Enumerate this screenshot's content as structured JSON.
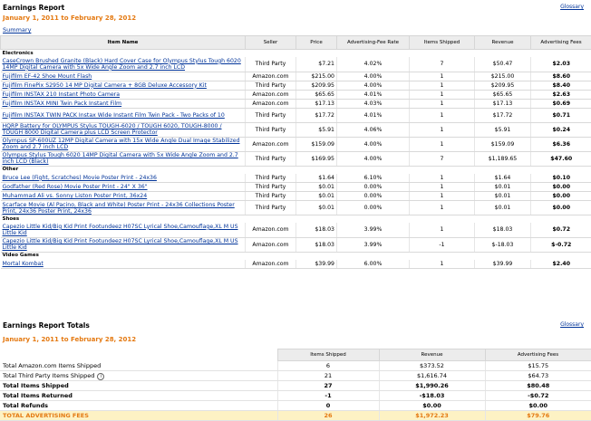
{
  "report": {
    "title": "Earnings Report",
    "glossary": "Glossary",
    "date_range": "January 1, 2011 to February 28, 2012",
    "summary_link": "Summary"
  },
  "columns": [
    "Item Name",
    "Seller",
    "Price",
    "Advertising-Fee Rate",
    "Items Shipped",
    "Revenue",
    "Advertising Fees"
  ],
  "categories": [
    {
      "name": "Electronics",
      "items": [
        {
          "name": "CaseCrown Brushed Granite (Black) Hard Cover Case for Olympus Stylus Tough 6020 14MP Digital Camera with 5x Wide Angle Zoom and 2.7 inch LCD",
          "seller": "Third Party",
          "price": "$7.21",
          "rate": "4.02%",
          "shipped": "7",
          "revenue": "$50.47",
          "fees": "$2.03"
        },
        {
          "name": "Fujifilm EF-42 Shoe Mount Flash",
          "seller": "Amazon.com",
          "price": "$215.00",
          "rate": "4.00%",
          "shipped": "1",
          "revenue": "$215.00",
          "fees": "$8.60"
        },
        {
          "name": "Fujifilm FinePix S2950 14 MP Digital Camera + 8GB Deluxe Accessory Kit",
          "seller": "Third Party",
          "price": "$209.95",
          "rate": "4.00%",
          "shipped": "1",
          "revenue": "$209.95",
          "fees": "$8.40"
        },
        {
          "name": "Fujifilm INSTAX 210 Instant Photo Camera",
          "seller": "Amazon.com",
          "price": "$65.65",
          "rate": "4.01%",
          "shipped": "1",
          "revenue": "$65.65",
          "fees": "$2.63"
        },
        {
          "name": "Fujifilm INSTAX MINI Twin Pack Instant Film",
          "seller": "Amazon.com",
          "price": "$17.13",
          "rate": "4.03%",
          "shipped": "1",
          "revenue": "$17.13",
          "fees": "$0.69"
        },
        {
          "name": "Fujifilm INSTAX TWIN PACK Instax Wide Instant Film Twin Pack - Two Packs of 10",
          "seller": "Third Party",
          "price": "$17.72",
          "rate": "4.01%",
          "shipped": "1",
          "revenue": "$17.72",
          "fees": "$0.71"
        },
        {
          "name": "HQRP Battery for OLYMPUS Stylus TOUGH-6020 / TOUGH 6020, TOUGH-8000 / TOUGH 8000 Digital Camera plus LCD Screen Protector",
          "seller": "Third Party",
          "price": "$5.91",
          "rate": "4.06%",
          "shipped": "1",
          "revenue": "$5.91",
          "fees": "$0.24"
        },
        {
          "name": "Olympus SP-600UZ 12MP Digital Camera with 15x Wide Angle Dual Image Stabilized Zoom and 2.7 inch LCD",
          "seller": "Amazon.com",
          "price": "$159.09",
          "rate": "4.00%",
          "shipped": "1",
          "revenue": "$159.09",
          "fees": "$6.36"
        },
        {
          "name": "Olympus Stylus Tough 6020 14MP Digital Camera with 5x Wide Angle Zoom and 2.7 inch LCD (Black)",
          "seller": "Third Party",
          "price": "$169.95",
          "rate": "4.00%",
          "shipped": "7",
          "revenue": "$1,189.65",
          "fees": "$47.60"
        }
      ]
    },
    {
      "name": "Other",
      "items": [
        {
          "name": "Bruce Lee (Fight, Scratches) Movie Poster Print - 24x36",
          "seller": "Third Party",
          "price": "$1.64",
          "rate": "6.10%",
          "shipped": "1",
          "revenue": "$1.64",
          "fees": "$0.10"
        },
        {
          "name": "Godfather (Red Rose) Movie Poster Print - 24\" X 36\"",
          "seller": "Third Party",
          "price": "$0.01",
          "rate": "0.00%",
          "shipped": "1",
          "revenue": "$0.01",
          "fees": "$0.00"
        },
        {
          "name": "Muhammad Ali vs. Sonny Liston Poster Print, 36x24",
          "seller": "Third Party",
          "price": "$0.01",
          "rate": "0.00%",
          "shipped": "1",
          "revenue": "$0.01",
          "fees": "$0.00"
        },
        {
          "name": "Scarface Movie (Al Pacino, Black and White) Poster Print - 24x36 Collections Poster Print, 24x36 Poster Print, 24x36",
          "seller": "Third Party",
          "price": "$0.01",
          "rate": "0.00%",
          "shipped": "1",
          "revenue": "$0.01",
          "fees": "$0.00"
        }
      ]
    },
    {
      "name": "Shoes",
      "items": [
        {
          "name": "Capezio Little Kid/Big Kid Print Footundeez H07SC Lyrical Shoe,Camouflage,XL M US Little Kid",
          "seller": "Amazon.com",
          "price": "$18.03",
          "rate": "3.99%",
          "shipped": "1",
          "revenue": "$18.03",
          "fees": "$0.72"
        },
        {
          "name": "Capezio Little Kid/Big Kid Print Footundeez H07SC Lyrical Shoe,Camouflage,XL M US Little Kid",
          "seller": "Amazon.com",
          "price": "$18.03",
          "rate": "3.99%",
          "shipped": "-1",
          "revenue": "$-18.03",
          "fees": "$-0.72"
        }
      ]
    },
    {
      "name": "Video Games",
      "items": [
        {
          "name": "Mortal Kombat",
          "seller": "Amazon.com",
          "price": "$39.99",
          "rate": "6.00%",
          "shipped": "1",
          "revenue": "$39.99",
          "fees": "$2.40"
        }
      ]
    }
  ],
  "totals": {
    "title": "Earnings Report Totals",
    "glossary": "Glossary",
    "date_range": "January 1, 2011 to February 28, 2012",
    "columns": [
      "Items Shipped",
      "Revenue",
      "Advertising Fees"
    ],
    "rows": [
      {
        "label": "Total Amazon.com Items Shipped",
        "shipped": "6",
        "revenue": "$373.52",
        "fees": "$15.75",
        "style": "normal",
        "info": false
      },
      {
        "label": "Total Third Party Items Shipped",
        "shipped": "21",
        "revenue": "$1,616.74",
        "fees": "$64.73",
        "style": "normal",
        "info": true
      },
      {
        "label": "Total Items Shipped",
        "shipped": "27",
        "revenue": "$1,990.26",
        "fees": "$80.48",
        "style": "bold",
        "info": false
      },
      {
        "label": "Total Items Returned",
        "shipped": "-1",
        "revenue": "-$18.03",
        "fees": "-$0.72",
        "style": "bold",
        "info": false
      },
      {
        "label": "Total Refunds",
        "shipped": "0",
        "revenue": "$0.00",
        "fees": "$0.00",
        "style": "bold",
        "info": false
      },
      {
        "label": "TOTAL ADVERTISING FEES",
        "shipped": "26",
        "revenue": "$1,972.23",
        "fees": "$79.76",
        "style": "final",
        "info": false
      }
    ]
  }
}
